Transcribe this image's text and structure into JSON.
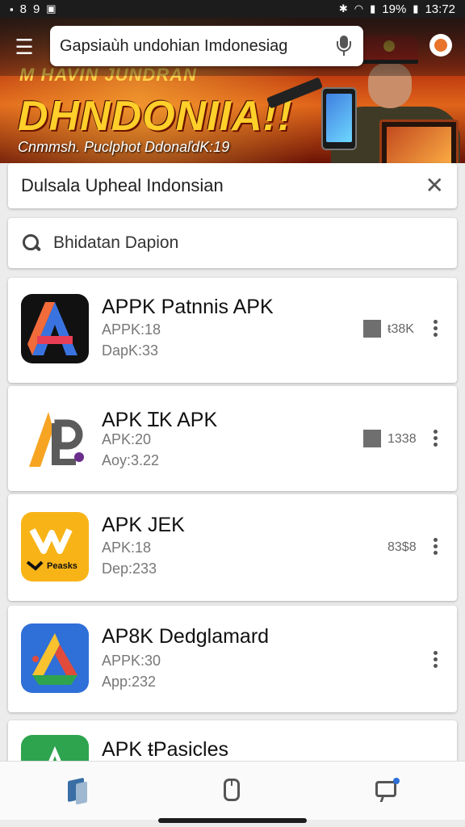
{
  "status_bar": {
    "time": "13:72",
    "battery": "19%",
    "left_icons": [
      "8",
      "9"
    ]
  },
  "top_bar": {
    "search_value": "Gapsiaùh undohian Imdonesiag",
    "menu_icon": "menu-icon",
    "mic_icon": "mic-icon"
  },
  "banner": {
    "headline_small": "M HAVIN JUNDRAN",
    "headline": "DHNDONIIA!!",
    "subtitle": "Cnmmsh. Puclphot DdonaľdK:19"
  },
  "filter_chip": {
    "label": "Dulsala Upheal Indonsian"
  },
  "search": {
    "placeholder": "Bhidatan Dapion"
  },
  "apps": [
    {
      "title": "APPK Patnnis APK",
      "line1": "APPK:18",
      "line2": "DapK:33",
      "size": "ŧ38K",
      "size_box": true,
      "icon": "apkpure-a-icon"
    },
    {
      "title": "APK ꞮK APK",
      "line1": "APK:20",
      "line2": "Aoy:3.22",
      "size": "1338",
      "size_box": true,
      "icon": "apk-l-logo-icon"
    },
    {
      "title": "APK JEK",
      "line1": "APK:18",
      "line2": "Dep:233",
      "size": "83$8",
      "size_box": false,
      "icon": "yellow-apk-icon"
    },
    {
      "title": "AP8K Dedglamard",
      "line1": "APPK:30",
      "line2": "App:232",
      "size": "",
      "size_box": false,
      "icon": "drive-triangle-icon"
    },
    {
      "title": "APK ŧPasicles",
      "line1": "",
      "line2": "",
      "size": "",
      "size_box": false,
      "icon": "green-a-icon"
    }
  ],
  "bottom_nav": [
    {
      "icon": "library-icon"
    },
    {
      "icon": "device-icon"
    },
    {
      "icon": "messages-icon"
    }
  ]
}
